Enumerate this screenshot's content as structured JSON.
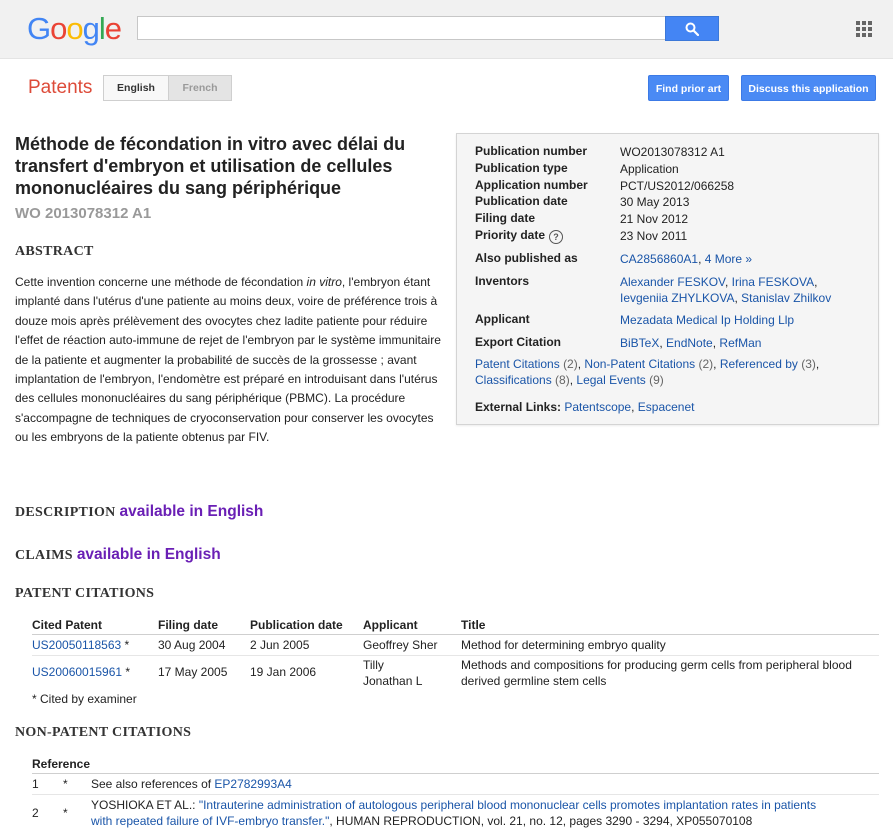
{
  "header": {
    "logo_letters": [
      {
        "ch": "G",
        "color": "#4285f4"
      },
      {
        "ch": "o",
        "color": "#ea4335"
      },
      {
        "ch": "o",
        "color": "#fbbc05"
      },
      {
        "ch": "g",
        "color": "#4285f4"
      },
      {
        "ch": "l",
        "color": "#34a853"
      },
      {
        "ch": "e",
        "color": "#ea4335"
      }
    ],
    "search_value": "",
    "search_icon": "magnifier-icon",
    "apps_icon": "grid-icon"
  },
  "toolbar": {
    "brand": "Patents",
    "lang_english": "English",
    "lang_french": "French",
    "find_prior_art": "Find prior art",
    "discuss": "Discuss this application"
  },
  "patent": {
    "title": "Méthode de fécondation in vitro avec délai du transfert d'embryon et utilisation de cellules mononucléaires du sang périphérique",
    "id": "WO 2013078312 A1"
  },
  "abstract": {
    "heading": "ABSTRACT",
    "text_before": "Cette invention concerne une méthode de fécondation ",
    "text_italic": "in vitro",
    "text_after": ", l'embryon étant implanté dans l'utérus d'une patiente au moins deux, voire de préférence trois à douze mois après prélèvement des ovocytes chez ladite patiente pour réduire l'effet de réaction auto-immune de rejet de l'embryon par le système immunitaire de la patiente et augmenter la probabilité de succès de la grossesse ; avant implantation de l'embryon, l'endomètre est préparé en introduisant dans l'utérus des cellules mononucléaires du sang périphérique (PBMC). La procédure s'accompagne de techniques de cryoconservation pour conserver les ovocytes ou les embryons de la patiente obtenus par FIV."
  },
  "meta": {
    "publication_number_label": "Publication number",
    "publication_number": "WO2013078312 A1",
    "publication_type_label": "Publication type",
    "publication_type": "Application",
    "application_number_label": "Application number",
    "application_number": "PCT/US2012/066258",
    "publication_date_label": "Publication date",
    "publication_date": "30 May 2013",
    "filing_date_label": "Filing date",
    "filing_date": "21 Nov 2012",
    "priority_date_label": "Priority date",
    "priority_date": "23 Nov 2011",
    "also_published_label": "Also published as",
    "also_published": "CA2856860A1",
    "also_more": "4 More »",
    "inventors_label": "Inventors",
    "inventors": [
      "Alexander FESKOV",
      "Irina FESKOVA",
      "Ievgeniia ZHYLKOVA",
      "Stanislav Zhilkov"
    ],
    "applicant_label": "Applicant",
    "applicant": "Mezadata Medical Ip Holding Llp",
    "export_label": "Export Citation",
    "export": [
      "BiBTeX",
      "EndNote",
      "RefMan"
    ],
    "counts": {
      "patent_citations": "Patent Citations",
      "patent_citations_n": "(2)",
      "non_patent": "Non-Patent Citations",
      "non_patent_n": "(2)",
      "referenced_by": "Referenced by",
      "referenced_by_n": "(3)",
      "classifications": "Classifications",
      "classifications_n": "(8)",
      "legal_events": "Legal Events",
      "legal_events_n": "(9)"
    },
    "external_label": "External Links:",
    "external": [
      "Patentscope",
      "Espacenet"
    ]
  },
  "description": {
    "heading": "DESCRIPTION",
    "link": "available in English"
  },
  "claims": {
    "heading": "CLAIMS",
    "link": "available in English"
  },
  "patent_citations": {
    "heading": "PATENT CITATIONS",
    "columns": [
      "Cited Patent",
      "Filing date",
      "Publication date",
      "Applicant",
      "Title"
    ],
    "rows": [
      {
        "patent": "US20050118563",
        "star": " *",
        "filing": "30 Aug 2004",
        "pub": "2 Jun 2005",
        "applicant": "Geoffrey Sher",
        "title": "Method for determining embryo quality"
      },
      {
        "patent": "US20060015961",
        "star": " *",
        "filing": "17 May 2005",
        "pub": "19 Jan 2006",
        "applicant": "Tilly Jonathan L",
        "title": "Methods and compositions for producing germ cells from peripheral blood derived germline stem cells"
      }
    ],
    "note": "* Cited by examiner"
  },
  "non_patent_citations": {
    "heading": "NON-PATENT CITATIONS",
    "column": "Reference",
    "rows": [
      {
        "n": "1",
        "star": "*",
        "before": "See also references of ",
        "link": "EP2782993A4",
        "after": ""
      },
      {
        "n": "2",
        "star": "*",
        "before": "YOSHIOKA ET AL.: ",
        "link": "\"Intrauterine administration of autologous peripheral blood mononuclear cells promotes implantation rates in patients with repeated failure of IVF-embryo transfer.\"",
        "after": ", HUMAN REPRODUCTION, vol. 21, no. 12, pages 3290 - 3294, XP055070108"
      }
    ]
  }
}
